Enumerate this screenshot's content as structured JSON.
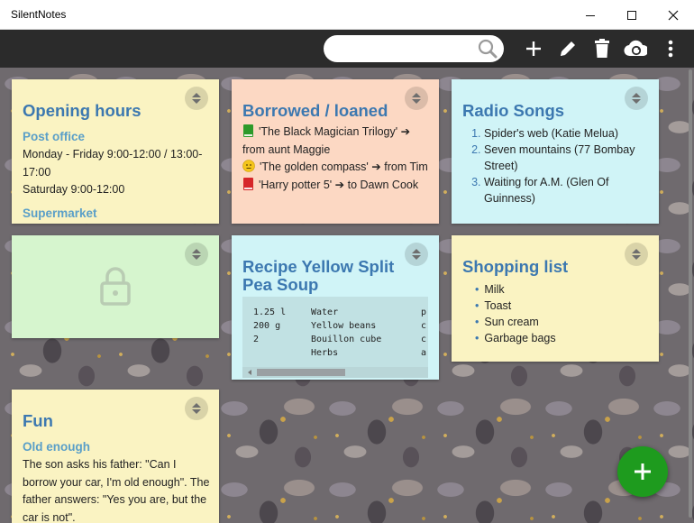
{
  "window": {
    "title": "SilentNotes"
  },
  "toolbar": {
    "search": {
      "value": "",
      "placeholder": ""
    },
    "icons": [
      "search-icon",
      "add-icon",
      "pencil-icon",
      "trash-icon",
      "cloud-sync-icon",
      "more-vert-icon"
    ]
  },
  "colors": {
    "accent": "#3c78b0",
    "yellow_note": "#faf3c2",
    "peach_note": "#fcd8c3",
    "cyan_note": "#d0f4f7",
    "green_note": "#d6f5ce",
    "fab": "#1e9b1e"
  },
  "notes": [
    {
      "title": "Opening hours",
      "sections": [
        {
          "heading": "Post office",
          "lines": [
            "Monday - Friday 9:00-12:00 / 13:00-17:00",
            "Saturday 9:00-12:00"
          ]
        },
        {
          "heading": "Supermarket",
          "lines": []
        }
      ]
    },
    {
      "title": "Borrowed / loaned",
      "items": [
        {
          "icon": "green-book-icon",
          "text": "'The Black Magician Trilogy' ➔ from aunt Maggie"
        },
        {
          "icon": "smiley-icon",
          "text": "'The golden compass' ➔ from Tim"
        },
        {
          "icon": "red-book-icon",
          "text": "'Harry potter 5' ➔ to Dawn Cook"
        }
      ]
    },
    {
      "title": "Radio Songs",
      "ordered": [
        "Spider's web (Katie Melua)",
        "Seven mountains (77 Bombay Street)",
        "Waiting for A.M. (Glen Of Guinness)"
      ]
    },
    {
      "title": "",
      "locked": true,
      "icon": "lock-icon"
    },
    {
      "title": "Recipe Yellow Split Pea Soup",
      "rows": [
        [
          "1.25 l",
          "Water",
          "p"
        ],
        [
          "200 g",
          "Yellow beans",
          "c"
        ],
        [
          "2",
          "Bouillon cube",
          "c"
        ],
        [
          "",
          "Herbs",
          "a"
        ]
      ]
    },
    {
      "title": "Shopping list",
      "bullets": [
        "Milk",
        "Toast",
        "Sun cream",
        "Garbage bags"
      ]
    },
    {
      "title": "Fun",
      "sections": [
        {
          "heading": "Old enough",
          "text": "The son asks his father: \"Can I borrow your car, I'm old enough\". The father answers: \"Yes you are, but the car is not\"."
        }
      ]
    }
  ],
  "fab": {
    "label": "+",
    "icon": "add-icon"
  }
}
